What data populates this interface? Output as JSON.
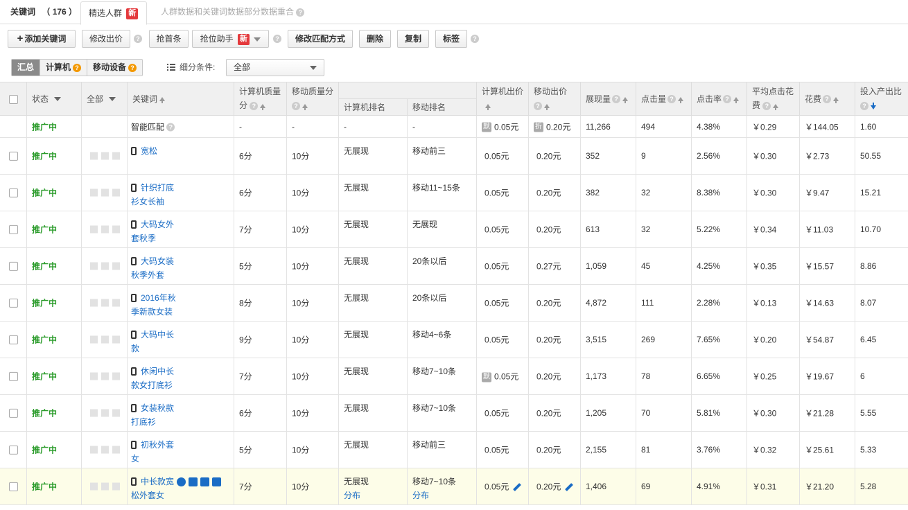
{
  "tabs": {
    "keyword_label": "关键词",
    "keyword_count": "（ 176 ）",
    "crowd_label": "精选人群",
    "new_badge": "新",
    "note": "人群数据和关键词数据部分数据重合"
  },
  "toolbar": {
    "add_keyword": "添加关键词",
    "edit_bid": "修改出价",
    "grab_top": "抢首条",
    "grab_assistant": "抢位助手",
    "new_badge": "新",
    "edit_match": "修改匹配方式",
    "delete": "删除",
    "copy": "复制",
    "tag": "标签"
  },
  "filter": {
    "summary": "汇总",
    "computer": "计算机",
    "mobile": "移动设备",
    "condition_label": "细分条件:",
    "select_value": "全部"
  },
  "headers": {
    "status": "状态",
    "all": "全部",
    "keyword": "关键词",
    "pc_quality_l1": "计算机质量",
    "pc_quality_l2": "分",
    "mobile_quality": "移动质量分",
    "pc_rank": "计算机排名",
    "mobile_rank": "移动排名",
    "pc_bid": "计算机出价",
    "mobile_bid": "移动出价",
    "impressions": "展现量",
    "clicks": "点击量",
    "ctr": "点击率",
    "avg_cpc_l1": "平均点击花",
    "avg_cpc_l2": "费",
    "cost": "花费",
    "roi": "投入产出比"
  },
  "smart_row": {
    "status": "推广中",
    "keyword": "智能匹配",
    "pc_quality": "-",
    "mobile_quality": "-",
    "pc_rank": "-",
    "mobile_rank": "-",
    "pc_bid_tag": "默",
    "pc_bid": "0.05元",
    "mobile_bid_tag": "折",
    "mobile_bid": "0.20元",
    "impressions": "11,266",
    "clicks": "494",
    "ctr": "4.38%",
    "avg_cpc": "￥0.29",
    "cost": "￥144.05",
    "roi": "1.60"
  },
  "rows": [
    {
      "status": "推广中",
      "kw1": "宽松",
      "kw2": "",
      "pc_q": "6分",
      "m_q": "10分",
      "pc_rank": "无展现",
      "m_rank": "移动前三",
      "pc_bid": "0.05元",
      "m_bid": "0.20元",
      "imp": "352",
      "clk": "9",
      "ctr": "2.56%",
      "cpc": "￥0.30",
      "cost": "￥2.73",
      "roi": "50.55"
    },
    {
      "status": "推广中",
      "kw1": "针织打底",
      "kw2": "衫女长袖",
      "pc_q": "6分",
      "m_q": "10分",
      "pc_rank": "无展现",
      "m_rank": "移动11~15条",
      "pc_bid": "0.05元",
      "m_bid": "0.20元",
      "imp": "382",
      "clk": "32",
      "ctr": "8.38%",
      "cpc": "￥0.30",
      "cost": "￥9.47",
      "roi": "15.21"
    },
    {
      "status": "推广中",
      "kw1": "大码女外",
      "kw2": "套秋季",
      "pc_q": "7分",
      "m_q": "10分",
      "pc_rank": "无展现",
      "m_rank": "无展现",
      "pc_bid": "0.05元",
      "m_bid": "0.20元",
      "imp": "613",
      "clk": "32",
      "ctr": "5.22%",
      "cpc": "￥0.34",
      "cost": "￥11.03",
      "roi": "10.70"
    },
    {
      "status": "推广中",
      "kw1": "大码女装",
      "kw2": "秋季外套",
      "pc_q": "5分",
      "m_q": "10分",
      "pc_rank": "无展现",
      "m_rank": "20条以后",
      "pc_bid": "0.05元",
      "m_bid": "0.27元",
      "imp": "1,059",
      "clk": "45",
      "ctr": "4.25%",
      "cpc": "￥0.35",
      "cost": "￥15.57",
      "roi": "8.86"
    },
    {
      "status": "推广中",
      "kw1": "2016年秋",
      "kw2": "季新款女装",
      "pc_q": "8分",
      "m_q": "10分",
      "pc_rank": "无展现",
      "m_rank": "20条以后",
      "pc_bid": "0.05元",
      "m_bid": "0.20元",
      "imp": "4,872",
      "clk": "111",
      "ctr": "2.28%",
      "cpc": "￥0.13",
      "cost": "￥14.63",
      "roi": "8.07"
    },
    {
      "status": "推广中",
      "kw1": "大码中长",
      "kw2": "款",
      "pc_q": "9分",
      "m_q": "10分",
      "pc_rank": "无展现",
      "m_rank": "移动4~6条",
      "pc_bid": "0.05元",
      "m_bid": "0.20元",
      "imp": "3,515",
      "clk": "269",
      "ctr": "7.65%",
      "cpc": "￥0.20",
      "cost": "￥54.87",
      "roi": "6.45"
    },
    {
      "status": "推广中",
      "kw1": "休闲中长",
      "kw2": "款女打底衫",
      "pc_q": "7分",
      "m_q": "10分",
      "pc_rank": "无展现",
      "m_rank": "移动7~10条",
      "pc_bid_tag": "默",
      "pc_bid": "0.05元",
      "m_bid": "0.20元",
      "imp": "1,173",
      "clk": "78",
      "ctr": "6.65%",
      "cpc": "￥0.25",
      "cost": "￥19.67",
      "roi": "6"
    },
    {
      "status": "推广中",
      "kw1": "女装秋款",
      "kw2": "打底衫",
      "pc_q": "6分",
      "m_q": "10分",
      "pc_rank": "无展现",
      "m_rank": "移动7~10条",
      "pc_bid": "0.05元",
      "m_bid": "0.20元",
      "imp": "1,205",
      "clk": "70",
      "ctr": "5.81%",
      "cpc": "￥0.30",
      "cost": "￥21.28",
      "roi": "5.55"
    },
    {
      "status": "推广中",
      "kw1": "初秋外套",
      "kw2": "女",
      "pc_q": "5分",
      "m_q": "10分",
      "pc_rank": "无展现",
      "m_rank": "移动前三",
      "pc_bid": "0.05元",
      "m_bid": "0.20元",
      "imp": "2,155",
      "clk": "81",
      "ctr": "3.76%",
      "cpc": "￥0.32",
      "cost": "￥25.61",
      "roi": "5.33"
    },
    {
      "status": "推广中",
      "kw1": "中长款宽",
      "kw2": "松外套女",
      "pc_q": "7分",
      "m_q": "10分",
      "pc_rank": "无展现",
      "pc_rank_link": "分布",
      "m_rank": "移动7~10条",
      "m_rank_link": "分布",
      "pc_bid": "0.05元",
      "m_bid": "0.20元",
      "imp": "1,406",
      "clk": "69",
      "ctr": "4.91%",
      "cpc": "￥0.31",
      "cost": "￥21.20",
      "roi": "5.28",
      "highlight": true
    }
  ],
  "colors": {
    "status_green": "#2a9b2a",
    "link_blue": "#1a6cc5",
    "badge_red": "#e4393c",
    "help_orange": "#f39800"
  }
}
